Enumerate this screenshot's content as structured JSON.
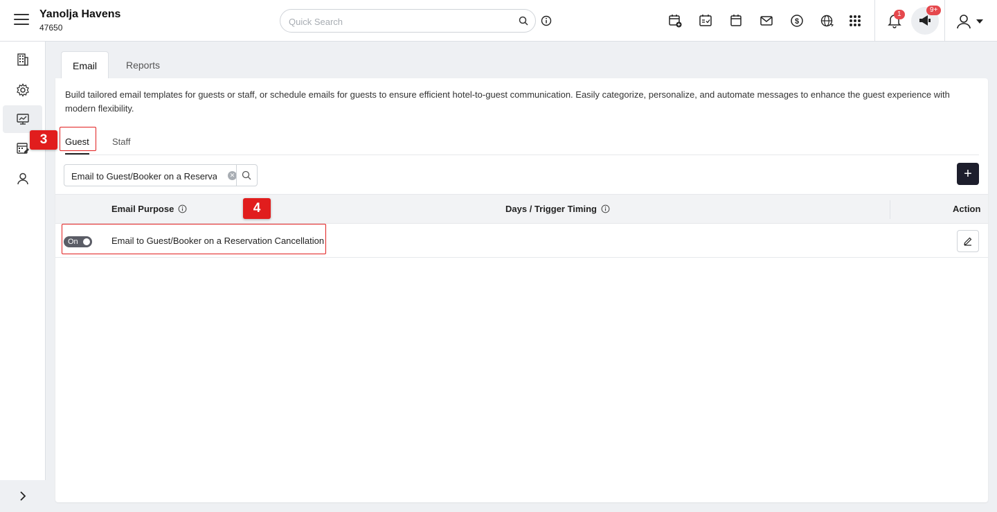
{
  "header": {
    "hotel_name": "Yanolja Havens",
    "hotel_id": "47650",
    "search_placeholder": "Quick Search",
    "notification_count": "1",
    "announcement_count": "9+"
  },
  "tabs": {
    "email": "Email",
    "reports": "Reports"
  },
  "description": "Build tailored email templates for guests or staff, or schedule emails for guests to ensure efficient hotel-to-guest communication. Easily categorize, personalize, and automate messages to enhance the guest experience with modern flexibility.",
  "sub_tabs": {
    "guest": "Guest",
    "staff": "Staff"
  },
  "filter": {
    "value": "Email to Guest/Booker on a Reservation Cancellation"
  },
  "table": {
    "columns": {
      "purpose": "Email Purpose",
      "timing": "Days / Trigger Timing",
      "action": "Action"
    },
    "rows": [
      {
        "status": "On",
        "purpose": "Email to Guest/Booker on a Reservation Cancellation",
        "timing": ""
      }
    ]
  },
  "annotations": {
    "step3": "3",
    "step4": "4"
  },
  "colors": {
    "accent": "#1d1e2c",
    "annotation": "#e11d1d",
    "badge": "#e5484d"
  }
}
